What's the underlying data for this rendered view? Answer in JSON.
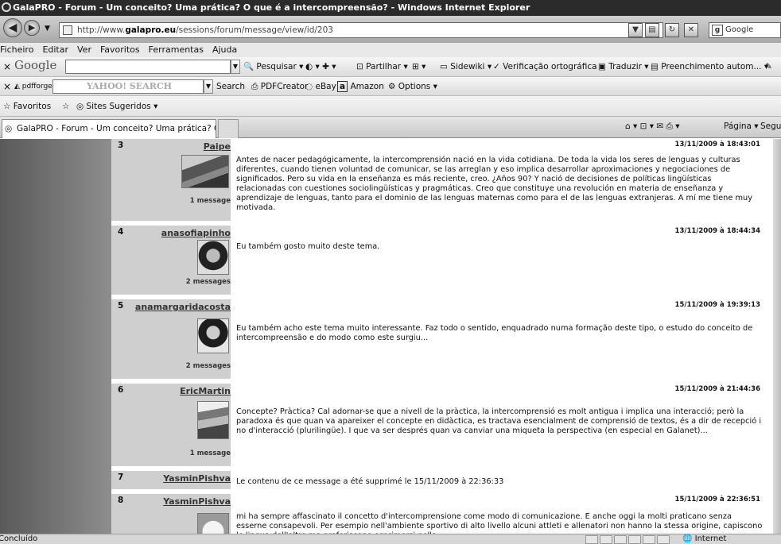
{
  "window": {
    "title": "GalaPRO - Forum - Um conceito? Uma prática? O que é a intercompreensão? - Windows Internet Explorer"
  },
  "address": {
    "url_prefix": "http://www.",
    "url_domain": "galapro.eu",
    "url_suffix": "/sessions/forum/message/view/id/203",
    "search_placeholder": "Google"
  },
  "menu": [
    "Ficheiro",
    "Editar",
    "Ver",
    "Favoritos",
    "Ferramentas",
    "Ajuda"
  ],
  "google_toolbar": {
    "close": "×",
    "logo": "Google",
    "pesquisar": "Pesquisar",
    "partilhar": "Partilhar",
    "sidewiki": "Sidewiki",
    "spellcheck": "Verificação ortográfica",
    "traduzir": "Traduzir",
    "preenchimento": "Preenchimento autom..."
  },
  "yahoo_toolbar": {
    "close": "×",
    "pdfforge": "pdfforge",
    "yahoo_logo": "YAHOO! SEARCH",
    "search_button": "Search",
    "pdfcreator": "PDFCreator",
    "ebay": "eBay",
    "amazon": "Amazon",
    "options": "Options"
  },
  "favorites_bar": {
    "favoritos": "Favoritos",
    "sites_sugeridos": "Sites Sugeridos"
  },
  "tabs": {
    "active_tab": "GalaPRO - Forum - Um conceito? Uma prática? O que ...",
    "pagina": "Página",
    "seguranca": "Segura"
  },
  "posts": [
    {
      "number": "3",
      "user": "Paipe",
      "messages": "1 message",
      "date": "13/11/2009 à 18:43:01",
      "text": "Antes de nacer pedagógicamente, la intercomprensión nació en la vida cotidiana. De toda la vida los seres de lenguas y culturas diferentes, cuando tienen voluntad de comunicar, se las arreglan y eso implica desarrollar aproximaciones y negociaciones de significados. Pero su vida en la enseñanza es más reciente, creo. ¿Años 90? Y nació de decisiones de políticas lingüísticas relacionadas con cuestiones sociolingüísticas y pragmáticas. Creo que constituye una revolución en materia de enseñanza y aprendizaje de lenguas, tanto para el dominio de las lenguas maternas como para el de las lenguas extranjeras. A mí me tiene muy motivada."
    },
    {
      "number": "4",
      "user": "anasofiapinho",
      "messages": "2 messages",
      "date": "13/11/2009 à 18:44:34",
      "text": "Eu também gosto muito deste tema."
    },
    {
      "number": "5",
      "user": "anamargaridacosta",
      "messages": "2 messages",
      "date": "15/11/2009 à 19:39:13",
      "text": "Eu também acho este tema muito interessante. Faz todo o sentido, enquadrado numa formação deste tipo, o estudo do conceito de intercompreensão e do modo como este surgiu..."
    },
    {
      "number": "6",
      "user": "EricMartin",
      "messages": "1 message",
      "date": "15/11/2009 à 21:44:36",
      "text": "Concepte? Pràctica? Cal adornar-se que a nivell de la pràctica, la intercomprensió es molt antigua i implica una interacció; però la paradoxa és que quan va apareixer el concepte en didàctica, es tractava esencialment de comprensió de textos, és a dir de recepció i no d'interacció (plurilingüe). I que va ser després quan va canviar una miqueta la perspectiva (en especial en Galanet)..."
    },
    {
      "number": "7",
      "user": "YasminPishva",
      "text": "Le contenu de ce message a été supprimé le 15/11/2009 à 22:36:33"
    },
    {
      "number": "8",
      "user": "YasminPishva",
      "date": "15/11/2009 à 22:36:51",
      "text": "mi ha sempre affascinato il concetto d'intercomprensione come modo di comunicazione. E anche oggi la molti praticano senza esserne consapevoli. Per esempio nell'ambiente sportivo di alto livello alcuni attleti e allenatori non hanno la stessa origine, capiscono le lingua dell'altro ma preferiscono esprimersi nella"
    }
  ],
  "status": {
    "left": "Concluído",
    "zone": "Internet"
  }
}
